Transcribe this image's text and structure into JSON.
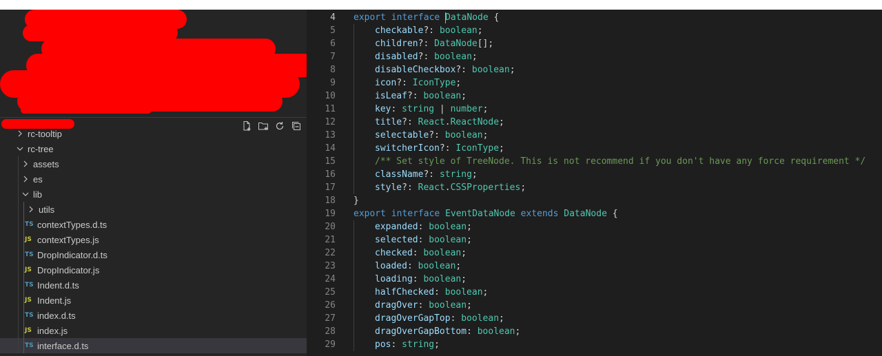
{
  "explorer": {
    "tree": [
      {
        "label": "rc-tooltip",
        "kind": "folder",
        "state": "collapsed",
        "level": 1
      },
      {
        "label": "rc-tree",
        "kind": "folder",
        "state": "expanded",
        "level": 1
      },
      {
        "label": "assets",
        "kind": "folder",
        "state": "collapsed",
        "level": 2
      },
      {
        "label": "es",
        "kind": "folder",
        "state": "collapsed",
        "level": 2
      },
      {
        "label": "lib",
        "kind": "folder",
        "state": "expanded",
        "level": 2
      },
      {
        "label": "utils",
        "kind": "folder",
        "state": "collapsed",
        "level": 3
      },
      {
        "label": "contextTypes.d.ts",
        "kind": "file",
        "badge": "TS",
        "level": 3
      },
      {
        "label": "contextTypes.js",
        "kind": "file",
        "badge": "JS",
        "level": 3
      },
      {
        "label": "DropIndicator.d.ts",
        "kind": "file",
        "badge": "TS",
        "level": 3
      },
      {
        "label": "DropIndicator.js",
        "kind": "file",
        "badge": "JS",
        "level": 3
      },
      {
        "label": "Indent.d.ts",
        "kind": "file",
        "badge": "TS",
        "level": 3
      },
      {
        "label": "Indent.js",
        "kind": "file",
        "badge": "JS",
        "level": 3
      },
      {
        "label": "index.d.ts",
        "kind": "file",
        "badge": "TS",
        "level": 3
      },
      {
        "label": "index.js",
        "kind": "file",
        "badge": "JS",
        "level": 3
      },
      {
        "label": "interface.d.ts",
        "kind": "file",
        "badge": "TS",
        "level": 3,
        "selected": true
      }
    ],
    "toolbar_icons": [
      "new-file-icon",
      "new-folder-icon",
      "refresh-icon",
      "collapse-all-icon"
    ]
  },
  "editor": {
    "lines": [
      {
        "n": "4",
        "current": true,
        "indent": 0,
        "tokens": [
          [
            "kw",
            "export "
          ],
          [
            "kw",
            "interface "
          ],
          [
            "cursor",
            ""
          ],
          [
            "ty",
            "DataNode"
          ],
          [
            "pu",
            " {"
          ]
        ]
      },
      {
        "n": "5",
        "indent": 1,
        "tokens": [
          [
            "pr",
            "checkable"
          ],
          [
            "pu",
            "?: "
          ],
          [
            "ty",
            "boolean"
          ],
          [
            "pu",
            ";"
          ]
        ]
      },
      {
        "n": "6",
        "indent": 1,
        "tokens": [
          [
            "pr",
            "children"
          ],
          [
            "pu",
            "?: "
          ],
          [
            "ty",
            "DataNode"
          ],
          [
            "pu",
            "[];"
          ]
        ]
      },
      {
        "n": "7",
        "indent": 1,
        "tokens": [
          [
            "pr",
            "disabled"
          ],
          [
            "pu",
            "?: "
          ],
          [
            "ty",
            "boolean"
          ],
          [
            "pu",
            ";"
          ]
        ]
      },
      {
        "n": "8",
        "indent": 1,
        "tokens": [
          [
            "pr",
            "disableCheckbox"
          ],
          [
            "pu",
            "?: "
          ],
          [
            "ty",
            "boolean"
          ],
          [
            "pu",
            ";"
          ]
        ]
      },
      {
        "n": "9",
        "indent": 1,
        "tokens": [
          [
            "pr",
            "icon"
          ],
          [
            "pu",
            "?: "
          ],
          [
            "ty",
            "IconType"
          ],
          [
            "pu",
            ";"
          ]
        ]
      },
      {
        "n": "10",
        "indent": 1,
        "tokens": [
          [
            "pr",
            "isLeaf"
          ],
          [
            "pu",
            "?: "
          ],
          [
            "ty",
            "boolean"
          ],
          [
            "pu",
            ";"
          ]
        ]
      },
      {
        "n": "11",
        "indent": 1,
        "tokens": [
          [
            "pr",
            "key"
          ],
          [
            "pu",
            ": "
          ],
          [
            "ty",
            "string"
          ],
          [
            "pu",
            " | "
          ],
          [
            "ty",
            "number"
          ],
          [
            "pu",
            ";"
          ]
        ]
      },
      {
        "n": "12",
        "indent": 1,
        "tokens": [
          [
            "pr",
            "title"
          ],
          [
            "pu",
            "?: "
          ],
          [
            "ty",
            "React"
          ],
          [
            "pu",
            "."
          ],
          [
            "ty",
            "ReactNode"
          ],
          [
            "pu",
            ";"
          ]
        ]
      },
      {
        "n": "13",
        "indent": 1,
        "tokens": [
          [
            "pr",
            "selectable"
          ],
          [
            "pu",
            "?: "
          ],
          [
            "ty",
            "boolean"
          ],
          [
            "pu",
            ";"
          ]
        ]
      },
      {
        "n": "14",
        "indent": 1,
        "tokens": [
          [
            "pr",
            "switcherIcon"
          ],
          [
            "pu",
            "?: "
          ],
          [
            "ty",
            "IconType"
          ],
          [
            "pu",
            ";"
          ]
        ]
      },
      {
        "n": "15",
        "indent": 1,
        "tokens": [
          [
            "cm",
            "/** Set style of TreeNode. This is not recommend if you don't have any force requirement */"
          ]
        ]
      },
      {
        "n": "16",
        "indent": 1,
        "tokens": [
          [
            "pr",
            "className"
          ],
          [
            "pu",
            "?: "
          ],
          [
            "ty",
            "string"
          ],
          [
            "pu",
            ";"
          ]
        ]
      },
      {
        "n": "17",
        "indent": 1,
        "tokens": [
          [
            "pr",
            "style"
          ],
          [
            "pu",
            "?: "
          ],
          [
            "ty",
            "React"
          ],
          [
            "pu",
            "."
          ],
          [
            "ty",
            "CSSProperties"
          ],
          [
            "pu",
            ";"
          ]
        ]
      },
      {
        "n": "18",
        "indent": 0,
        "tokens": [
          [
            "pu",
            "}"
          ]
        ]
      },
      {
        "n": "19",
        "indent": 0,
        "tokens": [
          [
            "kw",
            "export "
          ],
          [
            "kw",
            "interface "
          ],
          [
            "ty",
            "EventDataNode "
          ],
          [
            "kw",
            "extends "
          ],
          [
            "ty",
            "DataNode"
          ],
          [
            "pu",
            " {"
          ]
        ]
      },
      {
        "n": "20",
        "indent": 1,
        "tokens": [
          [
            "pr",
            "expanded"
          ],
          [
            "pu",
            ": "
          ],
          [
            "ty",
            "boolean"
          ],
          [
            "pu",
            ";"
          ]
        ]
      },
      {
        "n": "21",
        "indent": 1,
        "tokens": [
          [
            "pr",
            "selected"
          ],
          [
            "pu",
            ": "
          ],
          [
            "ty",
            "boolean"
          ],
          [
            "pu",
            ";"
          ]
        ]
      },
      {
        "n": "22",
        "indent": 1,
        "tokens": [
          [
            "pr",
            "checked"
          ],
          [
            "pu",
            ": "
          ],
          [
            "ty",
            "boolean"
          ],
          [
            "pu",
            ";"
          ]
        ]
      },
      {
        "n": "23",
        "indent": 1,
        "tokens": [
          [
            "pr",
            "loaded"
          ],
          [
            "pu",
            ": "
          ],
          [
            "ty",
            "boolean"
          ],
          [
            "pu",
            ";"
          ]
        ]
      },
      {
        "n": "24",
        "indent": 1,
        "tokens": [
          [
            "pr",
            "loading"
          ],
          [
            "pu",
            ": "
          ],
          [
            "ty",
            "boolean"
          ],
          [
            "pu",
            ";"
          ]
        ]
      },
      {
        "n": "25",
        "indent": 1,
        "tokens": [
          [
            "pr",
            "halfChecked"
          ],
          [
            "pu",
            ": "
          ],
          [
            "ty",
            "boolean"
          ],
          [
            "pu",
            ";"
          ]
        ]
      },
      {
        "n": "26",
        "indent": 1,
        "tokens": [
          [
            "pr",
            "dragOver"
          ],
          [
            "pu",
            ": "
          ],
          [
            "ty",
            "boolean"
          ],
          [
            "pu",
            ";"
          ]
        ]
      },
      {
        "n": "27",
        "indent": 1,
        "tokens": [
          [
            "pr",
            "dragOverGapTop"
          ],
          [
            "pu",
            ": "
          ],
          [
            "ty",
            "boolean"
          ],
          [
            "pu",
            ";"
          ]
        ]
      },
      {
        "n": "28",
        "indent": 1,
        "tokens": [
          [
            "pr",
            "dragOverGapBottom"
          ],
          [
            "pu",
            ": "
          ],
          [
            "ty",
            "boolean"
          ],
          [
            "pu",
            ";"
          ]
        ]
      },
      {
        "n": "29",
        "indent": 1,
        "tokens": [
          [
            "pr",
            "pos"
          ],
          [
            "pu",
            ": "
          ],
          [
            "ty",
            "string"
          ],
          [
            "pu",
            ";"
          ]
        ]
      }
    ]
  },
  "colors": {
    "sidebar_bg": "#252526",
    "editor_bg": "#1e1e1e",
    "keyword": "#569cd6",
    "type": "#4ec9b0",
    "property": "#9cdcfe",
    "comment": "#6a9955",
    "redaction": "#ff0000",
    "ts_badge": "#519aba",
    "js_badge": "#cbcb41"
  }
}
